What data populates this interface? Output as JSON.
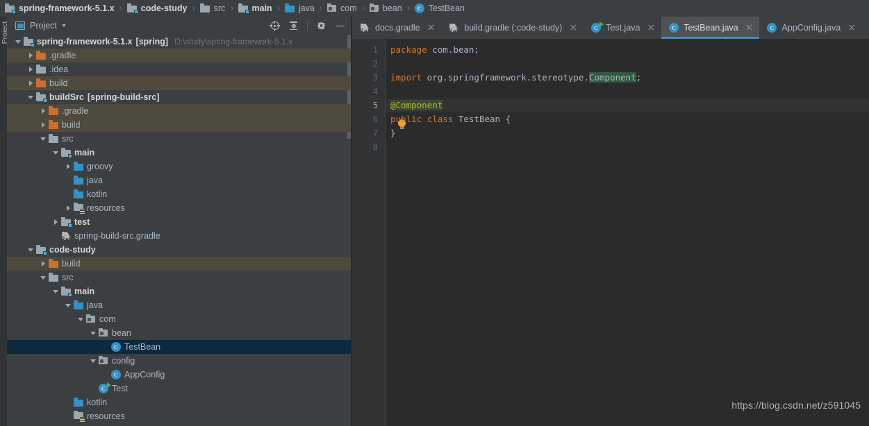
{
  "breadcrumb": {
    "separator": "›",
    "items": [
      {
        "label": "spring-framework-5.1.x",
        "icon": "module-folder-icon",
        "bold": true
      },
      {
        "label": "code-study",
        "icon": "module-folder-icon",
        "bold": true
      },
      {
        "label": "src",
        "icon": "folder-icon",
        "bold": false
      },
      {
        "label": "main",
        "icon": "module-folder-icon",
        "bold": true
      },
      {
        "label": "java",
        "icon": "source-folder-icon",
        "bold": false
      },
      {
        "label": "com",
        "icon": "package-icon",
        "bold": false
      },
      {
        "label": "bean",
        "icon": "package-icon",
        "bold": false
      },
      {
        "label": "TestBean",
        "icon": "java-class-icon",
        "bold": false
      }
    ]
  },
  "tool_strip": {
    "project_label": "Project"
  },
  "project_panel": {
    "title": "Project",
    "toolbar": {
      "select_opened_file_icon": "locate-target-icon",
      "collapse_all_icon": "collapse-all-icon",
      "settings_icon": "gear-icon",
      "hide_icon": "minimize-icon"
    },
    "tree": [
      {
        "label": "spring-framework-5.1.x",
        "module": "[spring]",
        "path": "D:\\study\\spring-framework-5.1.x",
        "indent": 0,
        "arrow": "down",
        "icon": "module-folder-icon",
        "bold": true,
        "state": "normal"
      },
      {
        "label": ".gradle",
        "indent": 1,
        "arrow": "right",
        "icon": "excluded-folder-icon",
        "bold": false,
        "state": "excluded"
      },
      {
        "label": ".idea",
        "indent": 1,
        "arrow": "right",
        "icon": "folder-icon",
        "bold": false,
        "state": "normal"
      },
      {
        "label": "build",
        "indent": 1,
        "arrow": "right",
        "icon": "excluded-folder-icon",
        "bold": false,
        "state": "excluded"
      },
      {
        "label": "buildSrc",
        "module": "[spring-build-src]",
        "indent": 1,
        "arrow": "down",
        "icon": "module-folder-icon",
        "bold": true,
        "state": "normal"
      },
      {
        "label": ".gradle",
        "indent": 2,
        "arrow": "right",
        "icon": "excluded-folder-icon",
        "bold": false,
        "state": "excluded"
      },
      {
        "label": "build",
        "indent": 2,
        "arrow": "right",
        "icon": "excluded-folder-icon",
        "bold": false,
        "state": "excluded"
      },
      {
        "label": "src",
        "indent": 2,
        "arrow": "down",
        "icon": "folder-icon",
        "bold": false,
        "state": "normal"
      },
      {
        "label": "main",
        "indent": 3,
        "arrow": "down",
        "icon": "module-folder-icon",
        "bold": true,
        "state": "normal"
      },
      {
        "label": "groovy",
        "indent": 4,
        "arrow": "right",
        "icon": "source-folder-icon",
        "bold": false,
        "state": "normal"
      },
      {
        "label": "java",
        "indent": 4,
        "arrow": "none",
        "icon": "source-folder-icon",
        "bold": false,
        "state": "normal"
      },
      {
        "label": "kotlin",
        "indent": 4,
        "arrow": "none",
        "icon": "source-folder-icon",
        "bold": false,
        "state": "normal"
      },
      {
        "label": "resources",
        "indent": 4,
        "arrow": "right",
        "icon": "resources-folder-icon",
        "bold": false,
        "state": "normal"
      },
      {
        "label": "test",
        "indent": 3,
        "arrow": "right",
        "icon": "module-folder-icon",
        "bold": true,
        "state": "normal"
      },
      {
        "label": "spring-build-src.gradle",
        "indent": 3,
        "arrow": "none",
        "icon": "gradle-file-icon",
        "bold": false,
        "state": "normal"
      },
      {
        "label": "code-study",
        "indent": 1,
        "arrow": "down",
        "icon": "module-folder-icon",
        "bold": true,
        "state": "normal"
      },
      {
        "label": "build",
        "indent": 2,
        "arrow": "right",
        "icon": "excluded-folder-icon",
        "bold": false,
        "state": "excluded"
      },
      {
        "label": "src",
        "indent": 2,
        "arrow": "down",
        "icon": "folder-icon",
        "bold": false,
        "state": "normal"
      },
      {
        "label": "main",
        "indent": 3,
        "arrow": "down",
        "icon": "module-folder-icon",
        "bold": true,
        "state": "normal"
      },
      {
        "label": "java",
        "indent": 4,
        "arrow": "down",
        "icon": "source-folder-icon",
        "bold": false,
        "state": "normal"
      },
      {
        "label": "com",
        "indent": 5,
        "arrow": "down",
        "icon": "package-icon",
        "bold": false,
        "state": "normal"
      },
      {
        "label": "bean",
        "indent": 6,
        "arrow": "down",
        "icon": "package-icon",
        "bold": false,
        "state": "normal"
      },
      {
        "label": "TestBean",
        "indent": 7,
        "arrow": "none",
        "icon": "java-class-icon",
        "bold": false,
        "state": "selected"
      },
      {
        "label": "config",
        "indent": 6,
        "arrow": "down",
        "icon": "package-icon",
        "bold": false,
        "state": "normal"
      },
      {
        "label": "AppConfig",
        "indent": 7,
        "arrow": "none",
        "icon": "java-class-icon",
        "bold": false,
        "state": "normal"
      },
      {
        "label": "Test",
        "indent": 6,
        "arrow": "none",
        "icon": "java-class-runnable-icon",
        "bold": false,
        "state": "normal"
      },
      {
        "label": "kotlin",
        "indent": 4,
        "arrow": "none",
        "icon": "source-folder-icon",
        "bold": false,
        "state": "normal"
      },
      {
        "label": "resources",
        "indent": 4,
        "arrow": "none",
        "icon": "resources-folder-icon",
        "bold": false,
        "state": "normal"
      }
    ]
  },
  "editor": {
    "tabs": [
      {
        "label": "docs.gradle",
        "icon": "gradle-file-icon",
        "active": false,
        "close": "×"
      },
      {
        "label": "build.gradle (:code-study)",
        "icon": "gradle-file-icon",
        "active": false,
        "close": "×"
      },
      {
        "label": "Test.java",
        "icon": "java-class-runnable-icon",
        "active": false,
        "close": "×"
      },
      {
        "label": "TestBean.java",
        "icon": "java-class-icon",
        "active": true,
        "close": "×"
      },
      {
        "label": "AppConfig.java",
        "icon": "java-class-icon",
        "active": false,
        "close": "×"
      }
    ],
    "gutter_icons": {
      "intention_bulb": "lightbulb-icon"
    },
    "line_numbers": [
      "1",
      "2",
      "3",
      "4",
      "5",
      "6",
      "7",
      "8"
    ],
    "caret_line": 5,
    "code_lines": [
      {
        "n": 1,
        "segments": [
          {
            "t": "package",
            "c": "kw"
          },
          {
            "t": " com.bean;",
            "c": ""
          }
        ]
      },
      {
        "n": 2,
        "segments": []
      },
      {
        "n": 3,
        "segments": [
          {
            "t": "import",
            "c": "kw"
          },
          {
            "t": " org.springframework.stereotype.",
            "c": ""
          },
          {
            "t": "Component",
            "c": "hl-green"
          },
          {
            "t": ";",
            "c": ""
          }
        ]
      },
      {
        "n": 4,
        "segments": []
      },
      {
        "n": 5,
        "segments": [
          {
            "t": "@Component",
            "c": "ann hl-ann"
          }
        ]
      },
      {
        "n": 6,
        "segments": [
          {
            "t": "public",
            "c": "kw"
          },
          {
            "t": " ",
            "c": ""
          },
          {
            "t": "class",
            "c": "kw"
          },
          {
            "t": " TestBean {",
            "c": ""
          }
        ]
      },
      {
        "n": 7,
        "segments": [
          {
            "t": "}",
            "c": ""
          }
        ]
      },
      {
        "n": 8,
        "segments": []
      }
    ]
  },
  "watermark": {
    "text": "https://blog.csdn.net/z591045"
  },
  "colors": {
    "window_bg": "#3c3f41",
    "editor_bg": "#2b2b2b",
    "gutter_bg": "#313335",
    "selection_bg": "#0d293e",
    "excluded_row_bg": "#4e4a3d",
    "active_tab_bg": "#4e5254",
    "active_tab_underline": "#4a88c7",
    "text_fg": "#a9b7c6",
    "keyword_fg": "#cc7832",
    "annotation_fg": "#bbb529",
    "accent_blue": "#3592c4",
    "folder_orange": "#cc6f32",
    "run_green": "#59a869"
  }
}
